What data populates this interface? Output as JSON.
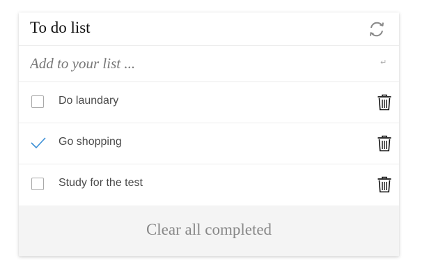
{
  "header": {
    "title": "To do list",
    "refresh_icon": "refresh-icon"
  },
  "add": {
    "placeholder": "Add to your list ...",
    "value": "",
    "enter_icon": "↵"
  },
  "todos": [
    {
      "label": "Do laundary",
      "completed": false
    },
    {
      "label": "Go shopping",
      "completed": true
    },
    {
      "label": "Study for the test",
      "completed": false
    }
  ],
  "footer": {
    "clear_label": "Clear all completed"
  },
  "colors": {
    "check": "#3b8fd6",
    "footer_bg": "#f4f4f4",
    "border": "#ececec"
  }
}
